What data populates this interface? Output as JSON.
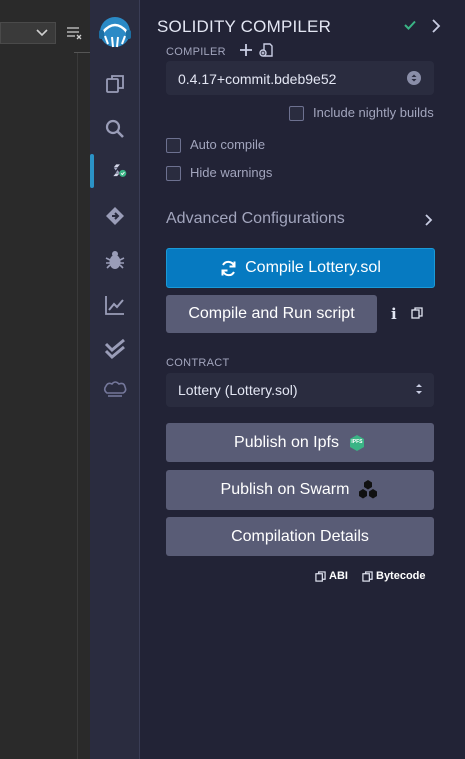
{
  "panel": {
    "title": "SOLIDITY COMPILER",
    "compiler_label": "COMPILER",
    "compiler_version": "0.4.17+commit.bdeb9e52",
    "include_nightly_label": "Include nightly builds",
    "auto_compile_label": "Auto compile",
    "hide_warnings_label": "Hide warnings",
    "advanced_label": "Advanced Configurations",
    "compile_button": "Compile Lottery.sol",
    "run_script_button": "Compile and Run script",
    "contract_label": "CONTRACT",
    "contract_selected": "Lottery (Lottery.sol)",
    "publish_ipfs": "Publish on Ipfs",
    "ipfs_badge": "IPFS",
    "publish_swarm": "Publish on Swarm",
    "compilation_details": "Compilation Details",
    "abi_label": "ABI",
    "bytecode_label": "Bytecode",
    "info_glyph": "i"
  },
  "colors": {
    "accent": "#067ac1",
    "success": "#3ab485",
    "button_gray": "#595c76",
    "panel_bg": "#222336"
  },
  "iconbar": {
    "icons": [
      "remix-logo-icon",
      "file-explorer-icon",
      "search-icon",
      "solidity-compiler-icon",
      "deploy-run-icon",
      "debugger-icon",
      "analysis-icon",
      "unit-testing-icon",
      "chef-hat-icon"
    ]
  }
}
